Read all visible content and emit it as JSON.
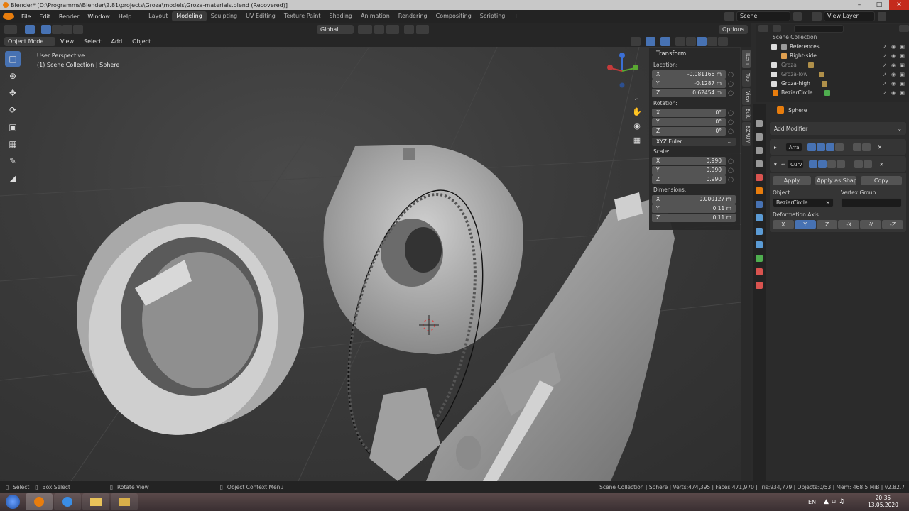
{
  "window": {
    "title": "Blender* [D:\\Programms\\Blender\\2.81\\projects\\Groza\\models\\Groza-materials.blend (Recovered)]"
  },
  "menu": [
    "File",
    "Edit",
    "Render",
    "Window",
    "Help"
  ],
  "workspaces": [
    {
      "label": "Layout",
      "active": false
    },
    {
      "label": "Modeling",
      "active": true
    },
    {
      "label": "Sculpting",
      "active": false
    },
    {
      "label": "UV Editing",
      "active": false
    },
    {
      "label": "Texture Paint",
      "active": false
    },
    {
      "label": "Shading",
      "active": false
    },
    {
      "label": "Animation",
      "active": false
    },
    {
      "label": "Rendering",
      "active": false
    },
    {
      "label": "Compositing",
      "active": false
    },
    {
      "label": "Scripting",
      "active": false
    }
  ],
  "scene": {
    "label": "Scene"
  },
  "view_layer": {
    "label": "View Layer"
  },
  "header": {
    "orientation": "Global",
    "options": "Options"
  },
  "viewport_header": {
    "mode": "Object Mode",
    "items": [
      "View",
      "Select",
      "Add",
      "Object"
    ]
  },
  "viewport": {
    "perspective": "User Perspective",
    "collection": "(1) Scene Collection | Sphere"
  },
  "transform": {
    "title": "Transform",
    "location_label": "Location:",
    "location": [
      {
        "axis": "X",
        "value": "-0.081166 m"
      },
      {
        "axis": "Y",
        "value": "-0.1287 m"
      },
      {
        "axis": "Z",
        "value": "0.62454 m"
      }
    ],
    "rotation_label": "Rotation:",
    "rotation": [
      {
        "axis": "X",
        "value": "0°"
      },
      {
        "axis": "Y",
        "value": "0°"
      },
      {
        "axis": "Z",
        "value": "0°"
      }
    ],
    "rotation_mode": "XYZ Euler",
    "scale_label": "Scale:",
    "scale": [
      {
        "axis": "X",
        "value": "0.990"
      },
      {
        "axis": "Y",
        "value": "0.990"
      },
      {
        "axis": "Z",
        "value": "0.990"
      }
    ],
    "dimensions_label": "Dimensions:",
    "dimensions": [
      {
        "axis": "X",
        "value": "0.000127 m"
      },
      {
        "axis": "Y",
        "value": "0.11 m"
      },
      {
        "axis": "Z",
        "value": "0.11 m"
      }
    ]
  },
  "side_tabs": [
    "Item",
    "Tool",
    "View",
    "Edit",
    "BZRUV"
  ],
  "outliner": {
    "root": "Scene Collection",
    "items": [
      {
        "label": "References",
        "color": "#9a9a9a"
      },
      {
        "label": "Right-side",
        "color": "#e0a050"
      },
      {
        "label": "Groza",
        "color": "#b0904a"
      },
      {
        "label": "Groza-low",
        "color": "#b0904a"
      },
      {
        "label": "Groza-high",
        "color": "#b0904a"
      },
      {
        "label": "BezierCircle",
        "color": "#4fae4f"
      }
    ]
  },
  "properties": {
    "object": "Sphere",
    "add_modifier": "Add Modifier",
    "modifiers": [
      {
        "name": "Arra",
        "expanded": false
      },
      {
        "name": "Curv",
        "expanded": true
      }
    ],
    "buttons": {
      "apply": "Apply",
      "apply_shape": "Apply as Shape...",
      "copy": "Copy"
    },
    "object_label": "Object:",
    "object_value": "BezierCircle",
    "vertex_group_label": "Vertex Group:",
    "deformation_axis_label": "Deformation Axis:",
    "axes": [
      {
        "label": "X",
        "active": false
      },
      {
        "label": "Y",
        "active": true
      },
      {
        "label": "Z",
        "active": false
      },
      {
        "label": "-X",
        "active": false
      },
      {
        "label": "-Y",
        "active": false
      },
      {
        "label": "-Z",
        "active": false
      }
    ]
  },
  "statusbar": {
    "select": "Select",
    "box_select": "Box Select",
    "rotate_view": "Rotate View",
    "context_menu": "Object Context Menu",
    "stats": "Scene Collection | Sphere | Verts:474,395 | Faces:471,970 | Tris:934,779 | Objects:0/53 | Mem: 468.5 MiB | v2.82.7"
  },
  "taskbar": {
    "lang": "EN",
    "time": "20:35",
    "date": "13.05.2020"
  },
  "colors": {
    "accent": "#4772b3",
    "orange": "#e87d0d",
    "bg": "#1d1d1d"
  }
}
